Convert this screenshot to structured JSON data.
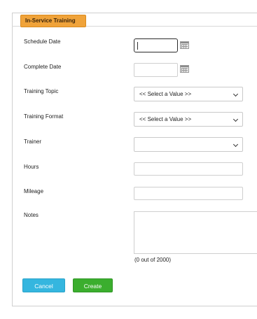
{
  "section": {
    "title": "In-Service Training"
  },
  "fields": {
    "schedule_date": {
      "label": "Schedule Date",
      "value": ""
    },
    "complete_date": {
      "label": "Complete Date",
      "value": ""
    },
    "training_topic": {
      "label": "Training Topic",
      "selected": "<< Select a Value >>"
    },
    "training_format": {
      "label": "Training Format",
      "selected": "<< Select a Value >>"
    },
    "trainer": {
      "label": "Trainer",
      "selected": ""
    },
    "hours": {
      "label": "Hours",
      "value": ""
    },
    "mileage": {
      "label": "Mileage",
      "value": ""
    },
    "notes": {
      "label": "Notes",
      "value": "",
      "counter": "(0 out of 2000)"
    }
  },
  "buttons": {
    "cancel": "Cancel",
    "create": "Create"
  },
  "colors": {
    "tab": "#f0a33a",
    "cancel": "#35b6df",
    "create": "#3bae2e"
  },
  "icons": {
    "date_picker": "calendar-icon",
    "dropdown": "chevron-down-icon"
  }
}
